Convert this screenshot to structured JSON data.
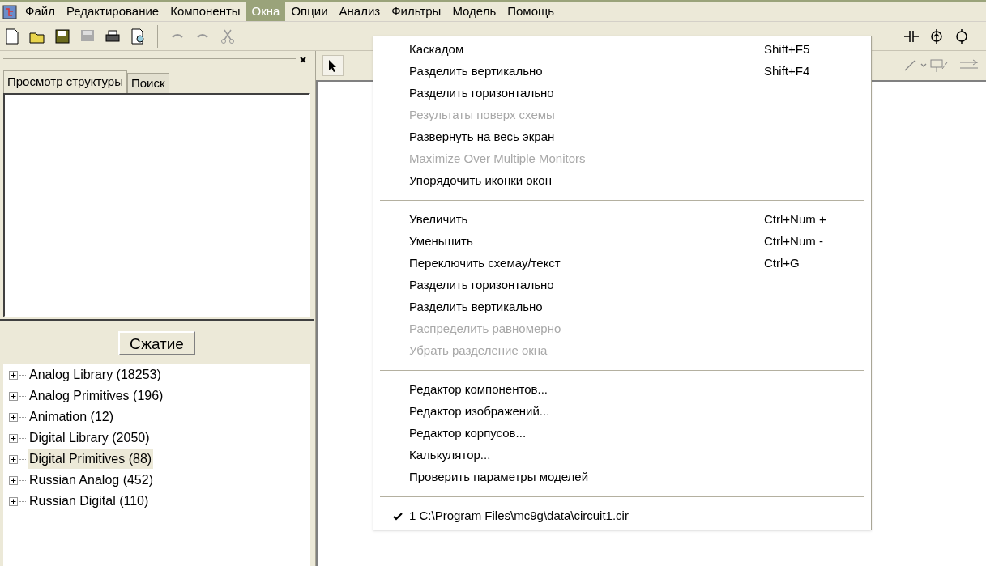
{
  "menubar": [
    {
      "label": "Файл",
      "selected": false
    },
    {
      "label": "Редактирование",
      "selected": false
    },
    {
      "label": "Компоненты",
      "selected": false
    },
    {
      "label": "Окна",
      "selected": true
    },
    {
      "label": "Опции",
      "selected": false
    },
    {
      "label": "Анализ",
      "selected": false
    },
    {
      "label": "Фильтры",
      "selected": false
    },
    {
      "label": "Модель",
      "selected": false
    },
    {
      "label": "Помощь",
      "selected": false
    }
  ],
  "left_panel": {
    "tabs": [
      {
        "label": "Просмотр структуры",
        "selected": true
      },
      {
        "label": "Поиск",
        "selected": false
      }
    ],
    "collapse_button": "Сжатие",
    "tree": [
      {
        "label": "Analog Library (18253)",
        "selected": false
      },
      {
        "label": "Analog Primitives (196)",
        "selected": false
      },
      {
        "label": "Animation (12)",
        "selected": false
      },
      {
        "label": "Digital Library (2050)",
        "selected": false
      },
      {
        "label": "Digital Primitives (88)",
        "selected": true
      },
      {
        "label": "Russian Analog (452)",
        "selected": false
      },
      {
        "label": "Russian Digital (110)",
        "selected": false
      }
    ]
  },
  "menu": [
    {
      "kind": "item",
      "label": "Каскадом",
      "shortcut": "Shift+F5",
      "disabled": false
    },
    {
      "kind": "item",
      "label": "Разделить вертикально",
      "shortcut": "Shift+F4",
      "disabled": false
    },
    {
      "kind": "item",
      "label": "Разделить горизонтально",
      "disabled": false
    },
    {
      "kind": "item",
      "label": "Результаты поверх схемы",
      "disabled": true
    },
    {
      "kind": "item",
      "label": "Развернуть на весь экран",
      "disabled": false
    },
    {
      "kind": "item",
      "label": "Maximize Over Multiple Monitors",
      "disabled": true
    },
    {
      "kind": "item",
      "label": "Упорядочить иконки окон",
      "disabled": false
    },
    {
      "kind": "separator"
    },
    {
      "kind": "item",
      "label": "Увеличить",
      "shortcut": "Ctrl+Num +",
      "disabled": false
    },
    {
      "kind": "item",
      "label": "Уменьшить",
      "shortcut": "Ctrl+Num -",
      "disabled": false
    },
    {
      "kind": "item",
      "label": "Переключить схемау/текст",
      "shortcut": "Ctrl+G",
      "disabled": false
    },
    {
      "kind": "item",
      "label": "Разделить горизонтально",
      "disabled": false
    },
    {
      "kind": "item",
      "label": "Разделить вертикально",
      "disabled": false
    },
    {
      "kind": "item",
      "label": "Распределить равномерно",
      "disabled": true
    },
    {
      "kind": "item",
      "label": "Убрать разделение окна",
      "disabled": true
    },
    {
      "kind": "separator"
    },
    {
      "kind": "item",
      "label": "Редактор компонентов...",
      "disabled": false
    },
    {
      "kind": "item",
      "label": "Редактор изображений...",
      "disabled": false
    },
    {
      "kind": "item",
      "label": "Редактор корпусов...",
      "disabled": false
    },
    {
      "kind": "item",
      "label": "Калькулятор...",
      "disabled": false
    },
    {
      "kind": "item",
      "label": "Проверить параметры моделей",
      "disabled": false
    },
    {
      "kind": "separator"
    },
    {
      "kind": "item",
      "label": "1 C:\\Program Files\\mc9g\\data\\circuit1.cir",
      "disabled": false,
      "checked": true
    }
  ]
}
